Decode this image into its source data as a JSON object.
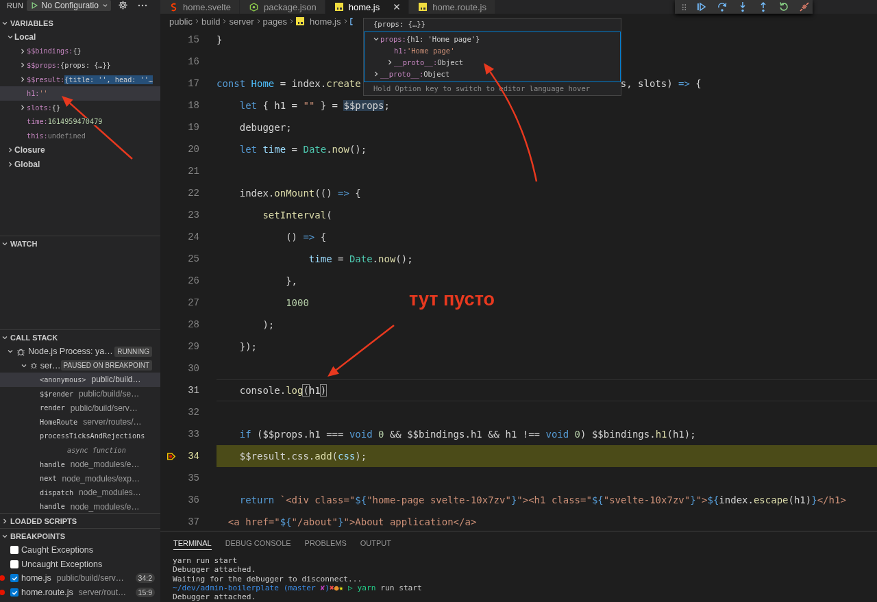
{
  "run_bar": {
    "label": "RUN",
    "configuration": "No Configuratio"
  },
  "variables": {
    "title": "VARIABLES",
    "expanded": true,
    "scopes": [
      {
        "name": "Local",
        "expanded": true,
        "children": [
          {
            "name": "$$bindings:",
            "value": "{}",
            "kind": "object",
            "expandable": true,
            "highlighted": false,
            "selected": false
          },
          {
            "name": "$$props:",
            "value": "{props: {…}}",
            "kind": "object",
            "expandable": true,
            "highlighted": false,
            "selected": false
          },
          {
            "name": "$$result:",
            "value": "{title: '', head: ''…",
            "kind": "object",
            "expandable": true,
            "highlighted": true,
            "selected": false
          },
          {
            "name": "h1:",
            "value": "''",
            "kind": "string",
            "expandable": false,
            "highlighted": false,
            "selected": true
          },
          {
            "name": "slots:",
            "value": "{}",
            "kind": "object",
            "expandable": true,
            "highlighted": false,
            "selected": false
          },
          {
            "name": "time:",
            "value": "1614959470479",
            "kind": "number",
            "expandable": false,
            "highlighted": false,
            "selected": false
          },
          {
            "name": "this:",
            "value": "undefined",
            "kind": "undefined",
            "expandable": false,
            "highlighted": false,
            "selected": false
          }
        ]
      },
      {
        "name": "Closure",
        "expanded": false
      },
      {
        "name": "Global",
        "expanded": false
      }
    ]
  },
  "watch": {
    "title": "WATCH",
    "expanded": true
  },
  "call_stack": {
    "title": "CALL STACK",
    "expanded": true,
    "sessions": [
      {
        "name": "Node.js Process: ya…",
        "badge": "RUNNING",
        "expanded": true,
        "threads": [
          {
            "name": "ser…",
            "badge": "PAUSED ON BREAKPOINT",
            "expanded": true,
            "frames": [
              {
                "kind": "frame",
                "name": "<anonymous>",
                "path": "public/build…",
                "selected": true
              },
              {
                "kind": "frame",
                "name": "$$render",
                "path": "public/build/se…",
                "selected": false
              },
              {
                "kind": "frame",
                "name": "render",
                "path": "public/build/serv…",
                "selected": false
              },
              {
                "kind": "frame",
                "name": "HomeRoute",
                "path": "server/routes/…",
                "selected": false
              },
              {
                "kind": "frame",
                "name": "processTicksAndRejections",
                "selected": false
              },
              {
                "kind": "separator",
                "label": "async function",
                "selected": false
              },
              {
                "kind": "frame",
                "name": "handle",
                "path": "node_modules/e…",
                "selected": false
              },
              {
                "kind": "frame",
                "name": "next",
                "path": "node_modules/exp…",
                "selected": false
              },
              {
                "kind": "frame",
                "name": "dispatch",
                "path": "node_modules…",
                "selected": false
              },
              {
                "kind": "frame",
                "name": "handle",
                "path": "node_modules/e…",
                "selected": false
              }
            ]
          }
        ]
      }
    ]
  },
  "loaded_scripts": {
    "title": "LOADED SCRIPTS",
    "expanded": false
  },
  "breakpoints": {
    "title": "BREAKPOINTS",
    "expanded": true,
    "items": [
      {
        "kind": "exception",
        "label": "Caught Exceptions",
        "checked": false
      },
      {
        "kind": "exception",
        "label": "Uncaught Exceptions",
        "checked": false
      },
      {
        "kind": "file",
        "label": "home.js",
        "path": "public/build/serv…",
        "location": "34:2",
        "checked": true
      },
      {
        "kind": "file",
        "label": "home.route.js",
        "path": "server/rout…",
        "location": "15:9",
        "checked": true
      }
    ]
  },
  "editor": {
    "tabs": [
      {
        "label": "home.svelte",
        "kind": "svelte",
        "selected": false
      },
      {
        "label": "package.json",
        "kind": "node",
        "selected": false
      },
      {
        "label": "home.js",
        "kind": "js",
        "selected": true
      },
      {
        "label": "home.route.js",
        "kind": "js",
        "selected": false
      }
    ],
    "breadcrumb": [
      {
        "label": "public",
        "kind": "folder"
      },
      {
        "label": "build",
        "kind": "folder"
      },
      {
        "label": "server",
        "kind": "folder"
      },
      {
        "label": "pages",
        "kind": "folder"
      },
      {
        "label": "home.js",
        "kind": "file"
      }
    ],
    "lines": [
      {
        "number": "15",
        "paused": false,
        "cursor": false,
        "tokens": [
          {
            "kind": "p",
            "text": "}"
          }
        ]
      },
      {
        "number": "16",
        "paused": false,
        "cursor": false
      },
      {
        "number": "17",
        "paused": false,
        "cursor": false,
        "tokens": [
          {
            "kind": "k",
            "text": "const "
          },
          {
            "kind": "c",
            "text": "Home"
          },
          {
            "kind": "p",
            "text": " = index."
          },
          {
            "kind": "f",
            "text": "create"
          },
          {
            "kind": "gap"
          },
          {
            "kind": "p",
            "text": "s, slots) "
          },
          {
            "kind": "k",
            "text": "=>"
          },
          {
            "kind": "p",
            "text": " {"
          }
        ]
      },
      {
        "number": "18",
        "paused": false,
        "cursor": false,
        "tokens": [
          {
            "kind": "k",
            "text": "    let"
          },
          {
            "kind": "p",
            "text": " { h1 = "
          },
          {
            "kind": "s",
            "text": "\"\""
          },
          {
            "kind": "p",
            "text": " } = "
          },
          {
            "kind": "hl",
            "text": "$$props"
          },
          {
            "kind": "p",
            "text": ";"
          }
        ]
      },
      {
        "number": "19",
        "paused": false,
        "cursor": false,
        "tokens": [
          {
            "kind": "p",
            "text": "    debugger;"
          }
        ]
      },
      {
        "number": "20",
        "paused": false,
        "cursor": false,
        "tokens": [
          {
            "kind": "k",
            "text": "    let "
          },
          {
            "kind": "v",
            "text": "time"
          },
          {
            "kind": "p",
            "text": " = "
          },
          {
            "kind": "t",
            "text": "Date"
          },
          {
            "kind": "p",
            "text": "."
          },
          {
            "kind": "f",
            "text": "now"
          },
          {
            "kind": "p",
            "text": "();"
          }
        ]
      },
      {
        "number": "21",
        "paused": false,
        "cursor": false
      },
      {
        "number": "22",
        "paused": false,
        "cursor": false,
        "tokens": [
          {
            "kind": "p",
            "text": "    index."
          },
          {
            "kind": "f",
            "text": "onMount"
          },
          {
            "kind": "p",
            "text": "(() "
          },
          {
            "kind": "k",
            "text": "=>"
          },
          {
            "kind": "p",
            "text": " {"
          }
        ]
      },
      {
        "number": "23",
        "paused": false,
        "cursor": false,
        "tokens": [
          {
            "kind": "f",
            "text": "        setInterval"
          },
          {
            "kind": "p",
            "text": "("
          }
        ]
      },
      {
        "number": "24",
        "paused": false,
        "cursor": false,
        "tokens": [
          {
            "kind": "p",
            "text": "            () "
          },
          {
            "kind": "k",
            "text": "=>"
          },
          {
            "kind": "p",
            "text": " {"
          }
        ]
      },
      {
        "number": "25",
        "paused": false,
        "cursor": false,
        "tokens": [
          {
            "kind": "v",
            "text": "                time"
          },
          {
            "kind": "p",
            "text": " = "
          },
          {
            "kind": "t",
            "text": "Date"
          },
          {
            "kind": "p",
            "text": "."
          },
          {
            "kind": "f",
            "text": "now"
          },
          {
            "kind": "p",
            "text": "();"
          }
        ]
      },
      {
        "number": "26",
        "paused": false,
        "cursor": false,
        "tokens": [
          {
            "kind": "p",
            "text": "            },"
          }
        ]
      },
      {
        "number": "27",
        "paused": false,
        "cursor": false,
        "tokens": [
          {
            "kind": "n",
            "text": "            1000"
          }
        ]
      },
      {
        "number": "28",
        "paused": false,
        "cursor": false,
        "tokens": [
          {
            "kind": "p",
            "text": "        );"
          }
        ]
      },
      {
        "number": "29",
        "paused": false,
        "cursor": false,
        "tokens": [
          {
            "kind": "p",
            "text": "    });"
          }
        ]
      },
      {
        "number": "30",
        "paused": false,
        "cursor": false
      },
      {
        "number": "31",
        "paused": false,
        "cursor": true,
        "tokens": [
          {
            "kind": "p",
            "text": "    console."
          },
          {
            "kind": "f",
            "text": "log"
          },
          {
            "kind": "bm",
            "text": "("
          },
          {
            "kind": "p",
            "text": "h1"
          },
          {
            "kind": "bm",
            "text": ")"
          }
        ]
      },
      {
        "number": "32",
        "paused": false,
        "cursor": false
      },
      {
        "number": "33",
        "paused": false,
        "cursor": false,
        "tokens": [
          {
            "kind": "k",
            "text": "    if"
          },
          {
            "kind": "p",
            "text": " ($$props.h1 === "
          },
          {
            "kind": "k",
            "text": "void"
          },
          {
            "kind": "n",
            "text": " 0"
          },
          {
            "kind": "p",
            "text": " && $$bindings.h1 && h1 !== "
          },
          {
            "kind": "k",
            "text": "void"
          },
          {
            "kind": "n",
            "text": " 0"
          },
          {
            "kind": "p",
            "text": ") $$bindings."
          },
          {
            "kind": "f",
            "text": "h1"
          },
          {
            "kind": "p",
            "text": "(h1);"
          }
        ]
      },
      {
        "number": "34",
        "paused": true,
        "cursor": false,
        "tokens": [
          {
            "kind": "p",
            "text": "    $$result.css."
          },
          {
            "kind": "f",
            "text": "add"
          },
          {
            "kind": "p",
            "text": "("
          },
          {
            "kind": "v",
            "text": "css"
          },
          {
            "kind": "p",
            "text": ");"
          }
        ]
      },
      {
        "number": "35",
        "paused": false,
        "cursor": false
      },
      {
        "number": "36",
        "paused": false,
        "cursor": false,
        "tokens": [
          {
            "kind": "k",
            "text": "    return"
          },
          {
            "kind": "s",
            "text": " `<div class=\""
          },
          {
            "kind": "k",
            "text": "${"
          },
          {
            "kind": "s",
            "text": "\"home-page svelte-10x7zv\""
          },
          {
            "kind": "k",
            "text": "}"
          },
          {
            "kind": "s",
            "text": "\"><h1 class=\""
          },
          {
            "kind": "k",
            "text": "${"
          },
          {
            "kind": "s",
            "text": "\"svelte-10x7zv\""
          },
          {
            "kind": "k",
            "text": "}"
          },
          {
            "kind": "s",
            "text": "\">"
          },
          {
            "kind": "k",
            "text": "${"
          },
          {
            "kind": "p",
            "text": "index."
          },
          {
            "kind": "f",
            "text": "escape"
          },
          {
            "kind": "p",
            "text": "(h1)"
          },
          {
            "kind": "k",
            "text": "}"
          },
          {
            "kind": "s",
            "text": "</h1>"
          }
        ]
      },
      {
        "number": "37",
        "paused": false,
        "cursor": false,
        "tokens": [
          {
            "kind": "s",
            "text": "  <a href=\""
          },
          {
            "kind": "k",
            "text": "${"
          },
          {
            "kind": "s",
            "text": "\"/about\""
          },
          {
            "kind": "k",
            "text": "}"
          },
          {
            "kind": "s",
            "text": "\">About application</a>"
          }
        ]
      }
    ]
  },
  "hover": {
    "title": "{props: {…}}",
    "tree": [
      {
        "name": "props:",
        "value": "{h1: 'Home page'}",
        "kind": "object",
        "expandable": true,
        "expanded": true,
        "children": [
          {
            "name": "h1:",
            "value": "'Home page'",
            "kind": "string",
            "expandable": false
          },
          {
            "name": "__proto__:",
            "value": "Object",
            "kind": "object",
            "expandable": true,
            "expanded": false
          }
        ]
      },
      {
        "name": "__proto__:",
        "value": "Object",
        "kind": "object",
        "expandable": true,
        "expanded": false
      }
    ],
    "hint": "Hold Option key to switch to editor language hover"
  },
  "panel": {
    "tabs": [
      {
        "label": "TERMINAL",
        "selected": true
      },
      {
        "label": "DEBUG CONSOLE",
        "selected": false
      },
      {
        "label": "PROBLEMS",
        "selected": false
      },
      {
        "label": "OUTPUT",
        "selected": false
      }
    ],
    "terminal": [
      [
        {
          "kind": "p",
          "text": "yarn run start"
        }
      ],
      [
        {
          "kind": "p",
          "text": "Debugger attached."
        }
      ],
      [
        {
          "kind": "p",
          "text": "Waiting for the debugger to disconnect..."
        }
      ],
      [
        {
          "kind": "path",
          "text": "~/dev/admin-boilerplate"
        },
        {
          "kind": "git",
          "text": " (master "
        },
        {
          "kind": "dirty",
          "text": "✘"
        },
        {
          "kind": "git",
          "text": ")"
        },
        {
          "kind": "x",
          "text": "✖"
        },
        {
          "kind": "dot",
          "text": "●"
        },
        {
          "kind": "star",
          "text": "★"
        },
        {
          "kind": "ok",
          "text": " ▷"
        },
        {
          "kind": "cmd",
          "text": " yarn"
        },
        {
          "kind": "p",
          "text": " run start"
        }
      ],
      [
        {
          "kind": "p",
          "text": "Debugger attached."
        }
      ]
    ]
  },
  "annotation": {
    "text": "тут пусто"
  }
}
